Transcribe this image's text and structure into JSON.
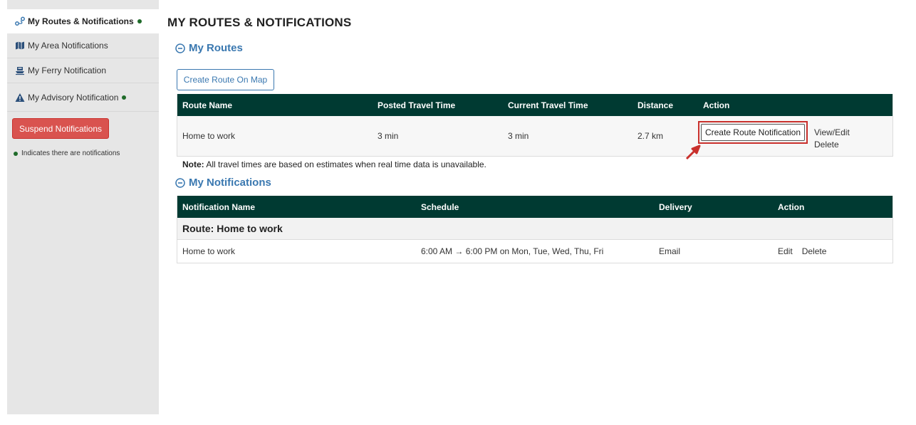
{
  "sidebar": {
    "items": [
      {
        "label": "My Routes & Notifications",
        "icon": "route-icon",
        "active": true,
        "has_notifications": true
      },
      {
        "label": "My Area Notifications",
        "icon": "map-icon",
        "active": false,
        "has_notifications": false
      },
      {
        "label": "My Ferry Notification",
        "icon": "ferry-icon",
        "active": false,
        "has_notifications": false
      },
      {
        "label": "My Advisory Notification",
        "icon": "warning-icon",
        "active": false,
        "has_notifications": true
      }
    ],
    "suspend_label": "Suspend Notifications",
    "legend_text": "Indicates there are notifications"
  },
  "page_title": "MY ROUTES & NOTIFICATIONS",
  "routes_section": {
    "title": "My Routes",
    "create_on_map_label": "Create Route On Map",
    "columns": [
      "Route Name",
      "Posted Travel Time",
      "Current Travel Time",
      "Distance",
      "Action"
    ],
    "rows": [
      {
        "name": "Home to work",
        "posted": "3 min",
        "current": "3 min",
        "distance": "2.7 km",
        "create_notification_label": "Create Route Notification",
        "view_edit": "View/Edit",
        "delete": "Delete"
      }
    ],
    "note_bold": "Note:",
    "note_text": " All travel times are based on estimates when real time data is unavailable."
  },
  "notifications_section": {
    "title": "My Notifications",
    "columns": [
      "Notification Name",
      "Schedule",
      "Delivery",
      "Action"
    ],
    "groups": [
      {
        "label": "Route: Home to work",
        "rows": [
          {
            "name": "Home to work",
            "schedule": "6:00 AM → 6:00 PM on Mon, Tue, Wed, Thu, Fri",
            "delivery": "Email",
            "edit": "Edit",
            "delete": "Delete"
          }
        ]
      }
    ]
  },
  "colors": {
    "sidebar_bg": "#e6e6e6",
    "header_bg": "#003a32",
    "accent_blue": "#3a78b0",
    "danger_red": "#d9534f",
    "notification_dot": "#1f6b2a"
  }
}
